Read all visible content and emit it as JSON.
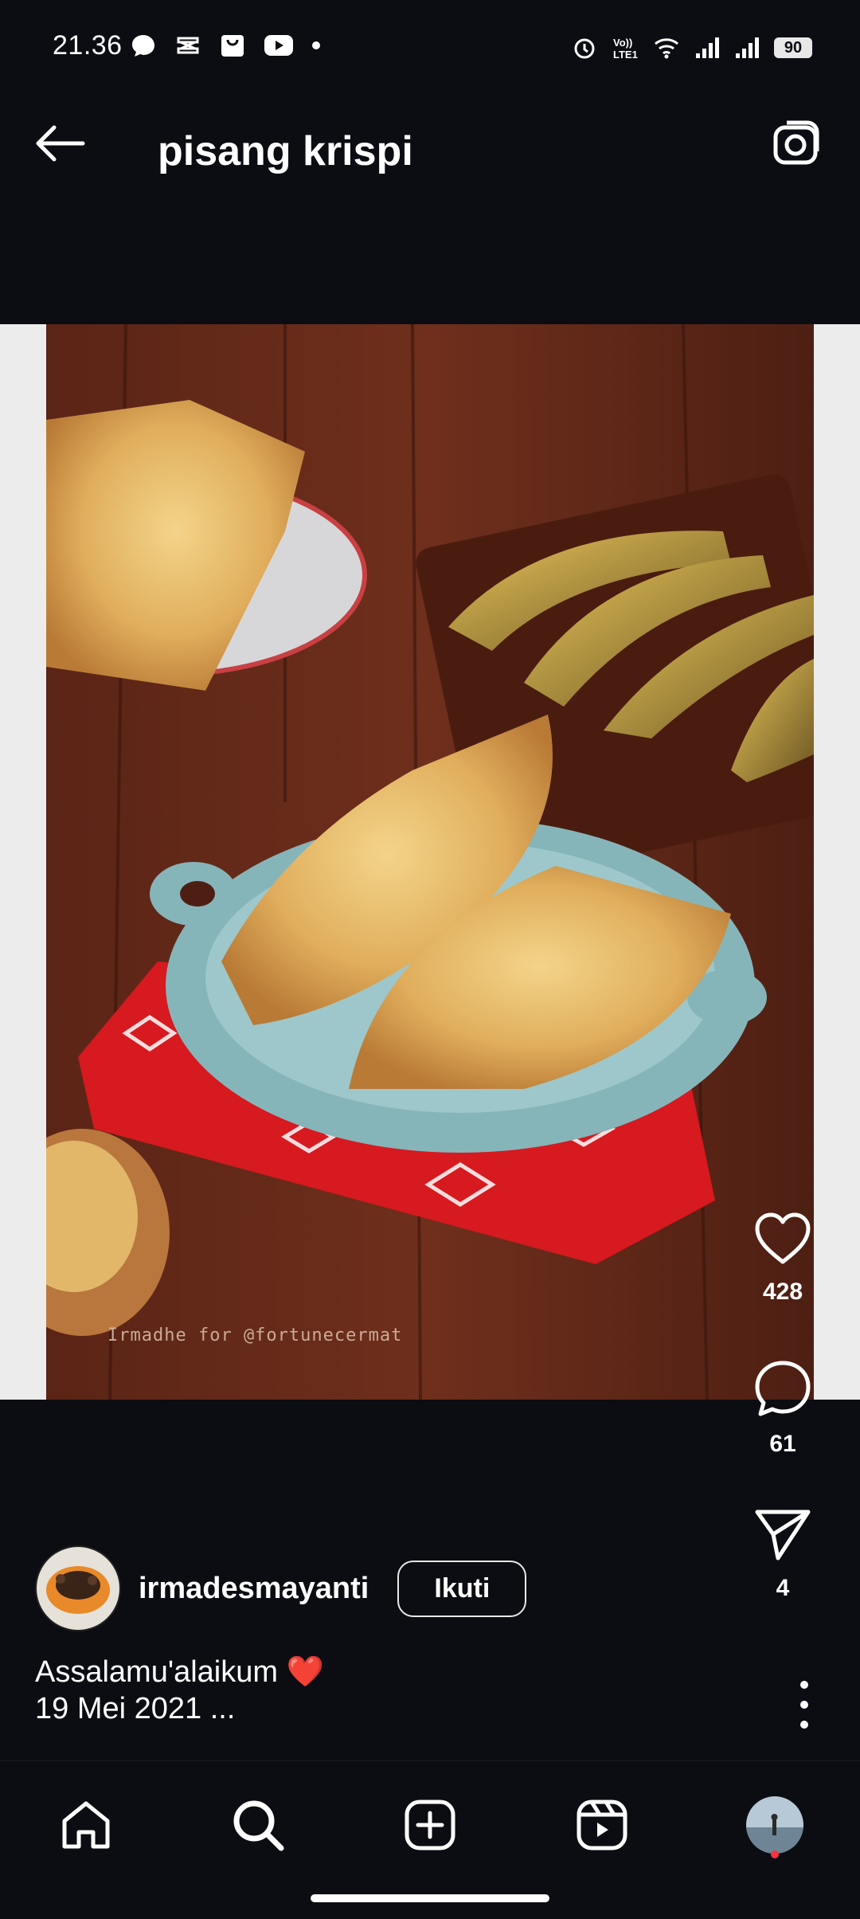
{
  "status": {
    "time": "21.36",
    "left_icons": [
      "chat-bubble-icon",
      "capcut-icon",
      "shopping-bag-icon",
      "youtube-icon",
      "dot-icon"
    ],
    "right_icons": [
      "alarm-icon",
      "volte-icon",
      "wifi-icon",
      "signal-icon",
      "signal-icon"
    ],
    "battery": "90"
  },
  "header": {
    "title": "pisang krispi"
  },
  "post": {
    "watermark": "Irmadhe for @fortunecermat",
    "likes": "428",
    "comments": "61",
    "shares": "4",
    "username": "irmadesmayanti",
    "follow_label": "Ikuti",
    "caption_line1": "Assalamu'alaikum ❤️",
    "caption_line2": "19 Mei 2021 ..."
  },
  "nav": {
    "items": [
      "home-icon",
      "search-icon",
      "add-icon",
      "reels-icon",
      "profile-avatar"
    ]
  },
  "colors": {
    "background": "#0b0d12",
    "accent_red": "#ff3040",
    "follow_border": "#e8e8e8"
  }
}
